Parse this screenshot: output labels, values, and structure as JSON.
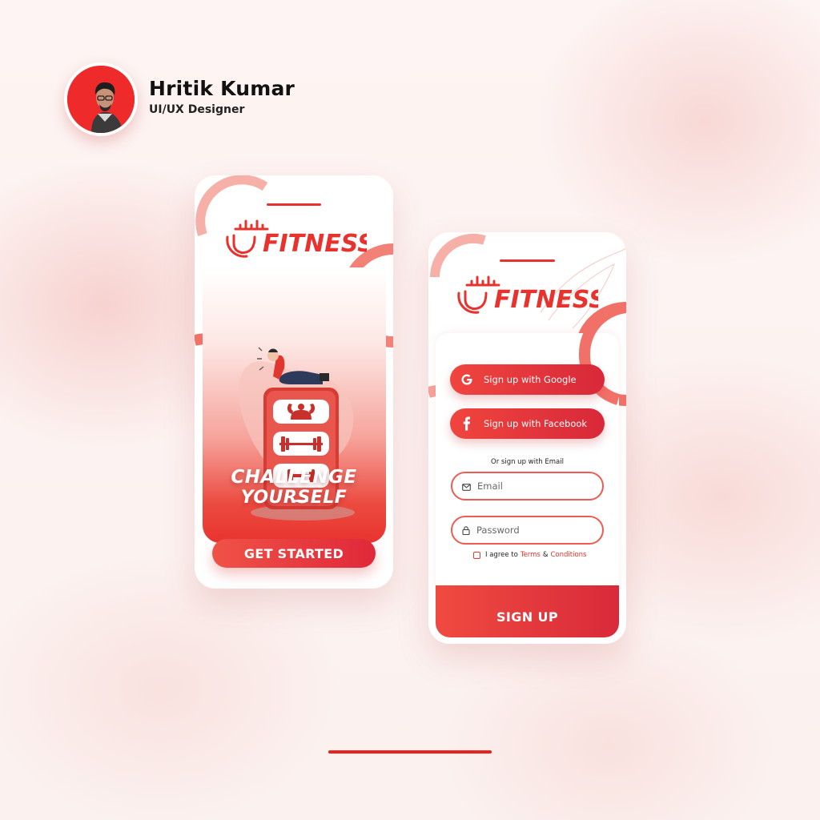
{
  "profile": {
    "name": "Hritik Kumar",
    "role": "UI/UX Designer"
  },
  "brand": {
    "logo_text": "FITNESS",
    "accent": "#e8322e",
    "accent_dark": "#d8283a"
  },
  "onboarding": {
    "headline_line1": "CHALLENGE",
    "headline_line2": "YOURSELF",
    "cta_label": "GET STARTED"
  },
  "signup": {
    "google_label": "Sign up with Google",
    "facebook_label": "Sign up with Facebook",
    "divider_text": "Or sign up with Email",
    "email_placeholder": "Email",
    "password_placeholder": "Password",
    "agree_prefix": "I agree to",
    "terms_label": "Terms",
    "and_text": "&",
    "conditions_label": "Conditions",
    "submit_label": "SIGN UP"
  }
}
